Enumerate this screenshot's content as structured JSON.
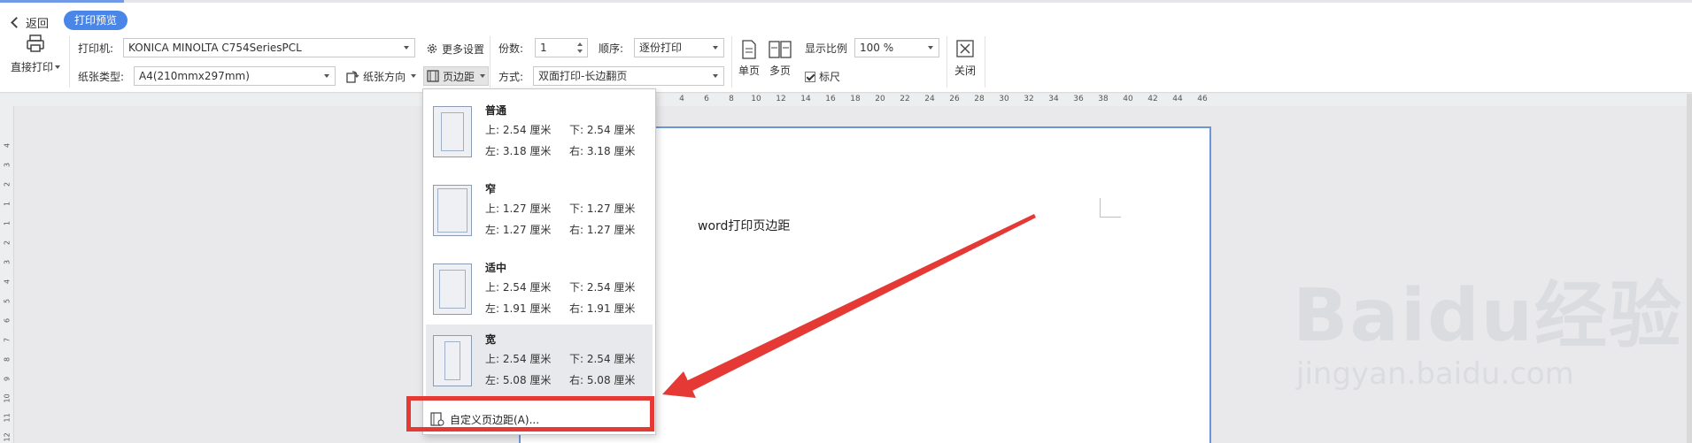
{
  "header": {
    "back_label": "返回",
    "mode_pill": "打印预览"
  },
  "print_button": {
    "label": "直接打印"
  },
  "printer": {
    "label": "打印机:",
    "value": "KONICA MINOLTA C754SeriesPCL"
  },
  "paper_type": {
    "label": "纸张类型:",
    "value": "A4(210mmx297mm)"
  },
  "more_settings": {
    "label": "更多设置"
  },
  "paper_orientation": {
    "label": "纸张方向"
  },
  "copies": {
    "label": "份数:",
    "value": "1"
  },
  "order": {
    "label": "顺序:",
    "value": "逐份打印"
  },
  "margins_button": {
    "label": "页边距"
  },
  "duplex": {
    "label": "方式:",
    "value": "双面打印-长边翻页"
  },
  "view": {
    "single_label": "单页",
    "multi_label": "多页",
    "ruler_label": "标尺",
    "ruler_checked": true,
    "zoom_label": "显示比例",
    "zoom_value": "100 %"
  },
  "close": {
    "label": "关闭"
  },
  "ruler": {
    "h_ticks": [
      "4",
      "6",
      "8",
      "10",
      "12",
      "14",
      "16",
      "18",
      "20",
      "22",
      "24",
      "26",
      "28",
      "30",
      "32",
      "34",
      "36",
      "38",
      "40",
      "42",
      "44",
      "46"
    ],
    "v_ticks": [
      "4",
      "3",
      "2",
      "1",
      "1",
      "2",
      "3",
      "4",
      "5",
      "6",
      "7",
      "8",
      "9",
      "10",
      "11",
      "12"
    ]
  },
  "document": {
    "text_fragment": "word打印页边距"
  },
  "margin_menu": {
    "options": [
      {
        "name": "普通",
        "top": "上: 2.54 厘米",
        "bottom": "下: 2.54 厘米",
        "left": "左: 3.18 厘米",
        "right": "右: 3.18 厘米"
      },
      {
        "name": "窄",
        "top": "上: 1.27 厘米",
        "bottom": "下: 1.27 厘米",
        "left": "左: 1.27 厘米",
        "right": "右: 1.27 厘米"
      },
      {
        "name": "适中",
        "top": "上: 2.54 厘米",
        "bottom": "下: 2.54 厘米",
        "left": "左: 1.91 厘米",
        "right": "右: 1.91 厘米"
      },
      {
        "name": "宽",
        "top": "上: 2.54 厘米",
        "bottom": "下: 2.54 厘米",
        "left": "左: 5.08 厘米",
        "right": "右: 5.08 厘米"
      }
    ],
    "custom_label": "自定义页边距(A)..."
  },
  "watermark": {
    "brand": "Baidu经验",
    "url": "jingyan.baidu.com"
  },
  "colors": {
    "accent": "#4a86e8",
    "annotation_red": "#e53935",
    "page_border": "#6d95d8"
  }
}
